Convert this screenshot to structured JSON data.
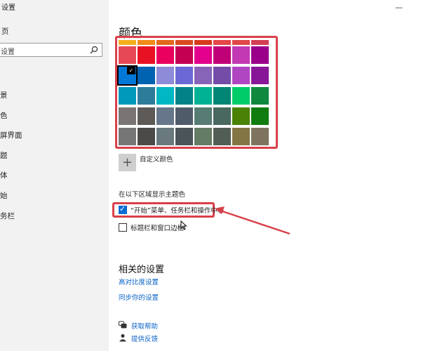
{
  "sidebar": {
    "title": "设置",
    "home": "页",
    "search_value": "设置",
    "items": [
      {
        "label": "景"
      },
      {
        "label": "色"
      },
      {
        "label": "屏界面"
      },
      {
        "label": "题"
      },
      {
        "label": "体"
      },
      {
        "label": "始"
      },
      {
        "label": "务栏"
      }
    ]
  },
  "window_controls": {
    "minimize": "—"
  },
  "main": {
    "section_title": "颜色",
    "top_strip_colors": [
      "#f2b01e",
      "#f28a1a",
      "#e3671d",
      "#d84a1f",
      "#d8391b",
      "#e44649",
      "#e04848",
      "#d33f55"
    ],
    "swatch_rows": [
      [
        "#e74856",
        "#e81123",
        "#ea005e",
        "#c30052",
        "#e3008c",
        "#bf0077",
        "#c239b3",
        "#9a0089"
      ],
      [
        "#0078d7",
        "#0063b1",
        "#8e8cd8",
        "#6b69d6",
        "#8764b8",
        "#744da9",
        "#b146c2",
        "#881798"
      ],
      [
        "#0099bc",
        "#2d7d9a",
        "#00b7c3",
        "#038387",
        "#00b294",
        "#018574",
        "#00cc6a",
        "#10893e"
      ],
      [
        "#7a7574",
        "#5d5a58",
        "#68768a",
        "#515c6b",
        "#567c73",
        "#486860",
        "#498205",
        "#107c10"
      ],
      [
        "#767676",
        "#4c4a48",
        "#69797e",
        "#4a5459",
        "#647c64",
        "#525e54",
        "#847545",
        "#7e735f"
      ]
    ],
    "selected_swatch": "#0078d7",
    "custom_color_label": "自定义颜色",
    "accent_surfaces_heading": "在以下区域显示主题色",
    "checkbox_start": {
      "label": "“开始”菜单、任务栏和操作中心",
      "checked": true
    },
    "checkbox_titlebar": {
      "label": "标题栏和窗口边框",
      "checked": false
    },
    "related_title": "相关的设置",
    "links": [
      "高对比度设置",
      "同步你的设置"
    ],
    "help": [
      {
        "label": "获取帮助",
        "icon": "help-chat-icon"
      },
      {
        "label": "提供反馈",
        "icon": "feedback-person-icon"
      }
    ]
  },
  "annotation_color": "#d9404a",
  "accent_color": "#0078d7"
}
